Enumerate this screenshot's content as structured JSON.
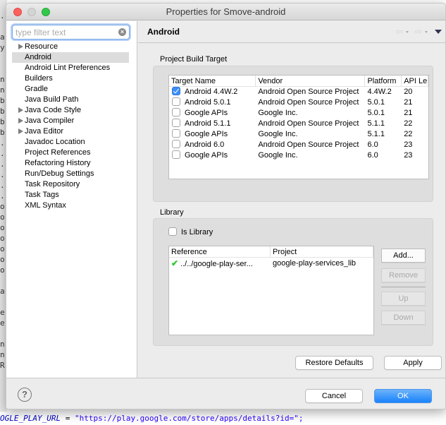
{
  "background": {
    "left_gutter_lines": [
      "",
      ".",
      "",
      "a",
      "y",
      "",
      "",
      "n",
      "n",
      "b",
      "b",
      "b",
      "b",
      ".",
      ".",
      ".",
      ".",
      ".",
      ".",
      "o",
      "o",
      "o",
      "o",
      "o",
      "o",
      "o",
      "",
      "a",
      "",
      "e",
      "e",
      "",
      "n",
      "n",
      "R"
    ],
    "code_line_ident": "OGLE_PLAY_URL",
    "code_line_op": " = ",
    "code_line_string": "\"https://play.google.com/store/apps/details?id=\";"
  },
  "window": {
    "title": "Properties for Smove-android"
  },
  "filter": {
    "placeholder": "type filter text",
    "clear_icon": "clear-icon"
  },
  "tree": {
    "items": [
      {
        "label": "Resource",
        "expandable": true,
        "selected": false
      },
      {
        "label": "Android",
        "expandable": false,
        "selected": true
      },
      {
        "label": "Android Lint Preferences",
        "expandable": false,
        "selected": false
      },
      {
        "label": "Builders",
        "expandable": false,
        "selected": false
      },
      {
        "label": "Gradle",
        "expandable": false,
        "selected": false
      },
      {
        "label": "Java Build Path",
        "expandable": false,
        "selected": false
      },
      {
        "label": "Java Code Style",
        "expandable": true,
        "selected": false
      },
      {
        "label": "Java Compiler",
        "expandable": true,
        "selected": false
      },
      {
        "label": "Java Editor",
        "expandable": true,
        "selected": false
      },
      {
        "label": "Javadoc Location",
        "expandable": false,
        "selected": false
      },
      {
        "label": "Project References",
        "expandable": false,
        "selected": false
      },
      {
        "label": "Refactoring History",
        "expandable": false,
        "selected": false
      },
      {
        "label": "Run/Debug Settings",
        "expandable": false,
        "selected": false
      },
      {
        "label": "Task Repository",
        "expandable": false,
        "selected": false
      },
      {
        "label": "Task Tags",
        "expandable": false,
        "selected": false
      },
      {
        "label": "XML Syntax",
        "expandable": false,
        "selected": false
      }
    ]
  },
  "page": {
    "title": "Android",
    "back_icon": "⇦",
    "forward_icon": "⇨"
  },
  "build_target": {
    "label": "Project Build Target",
    "columns": [
      "Target Name",
      "Vendor",
      "Platform",
      "API Le"
    ],
    "rows": [
      {
        "checked": true,
        "name": "Android 4.4W.2",
        "vendor": "Android Open Source Project",
        "platform": "4.4W.2",
        "api": "20"
      },
      {
        "checked": false,
        "name": "Android 5.0.1",
        "vendor": "Android Open Source Project",
        "platform": "5.0.1",
        "api": "21"
      },
      {
        "checked": false,
        "name": "Google APIs",
        "vendor": "Google Inc.",
        "platform": "5.0.1",
        "api": "21"
      },
      {
        "checked": false,
        "name": "Android 5.1.1",
        "vendor": "Android Open Source Project",
        "platform": "5.1.1",
        "api": "22"
      },
      {
        "checked": false,
        "name": "Google APIs",
        "vendor": "Google Inc.",
        "platform": "5.1.1",
        "api": "22"
      },
      {
        "checked": false,
        "name": "Android 6.0",
        "vendor": "Android Open Source Project",
        "platform": "6.0",
        "api": "23"
      },
      {
        "checked": false,
        "name": "Google APIs",
        "vendor": "Google Inc.",
        "platform": "6.0",
        "api": "23"
      }
    ]
  },
  "library": {
    "label": "Library",
    "is_library_label": "Is Library",
    "is_library_checked": false,
    "columns": [
      "Reference",
      "Project"
    ],
    "rows": [
      {
        "reference": "../../google-play-ser...",
        "project": "google-play-services_lib",
        "status": "ok"
      }
    ],
    "buttons": {
      "add": "Add...",
      "remove": "Remove",
      "up": "Up",
      "down": "Down"
    }
  },
  "actions": {
    "restore_defaults": "Restore Defaults",
    "apply": "Apply"
  },
  "footer": {
    "help": "?",
    "cancel": "Cancel",
    "ok": "OK"
  },
  "colors": {
    "accent": "#1a82fb",
    "check_green": "#2ec42e",
    "close": "#fc605c",
    "maximize": "#34c84a"
  }
}
